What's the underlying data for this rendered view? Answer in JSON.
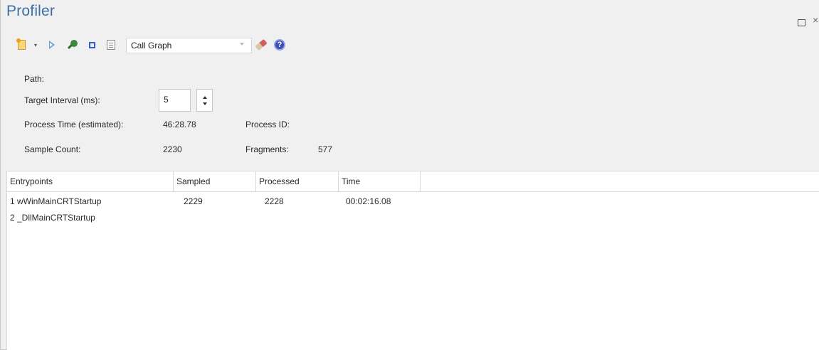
{
  "window": {
    "title": "Profiler",
    "maximize_glyph": "",
    "close_glyph": "×"
  },
  "toolbar": {
    "icons": [
      "new-document-icon",
      "chevron-down-icon",
      "play-icon",
      "search-icon",
      "stop-icon",
      "report-icon",
      "eraser-icon",
      "help-icon"
    ],
    "view_select_value": "Call Graph",
    "dropdown_arrow_glyph": "▾",
    "help_glyph": "?"
  },
  "form": {
    "path_label": "Path:",
    "target_interval_label": "Target Interval (ms):",
    "target_interval_value": "5",
    "process_time_label": "Process Time (estimated):",
    "process_time_value": "46:28.78",
    "process_id_label": "Process ID:",
    "sample_count_label": "Sample Count:",
    "sample_count_value": "2230",
    "fragments_label": "Fragments:",
    "fragments_value": "577"
  },
  "grid": {
    "columns": [
      "Entrypoints",
      "Sampled",
      "Processed",
      "Time"
    ],
    "rows": [
      {
        "entrypoint": "1 wWinMainCRTStartup",
        "sampled": "2229",
        "processed": "2228",
        "time": "00:02:16.08"
      },
      {
        "entrypoint": "2 _DllMainCRTStartup",
        "sampled": "",
        "processed": "",
        "time": ""
      }
    ]
  },
  "colors": {
    "title": "#3c6fa6",
    "panel_bg": "#f0f0f0",
    "grid_bg": "#ffffff",
    "stop_icon": "#2f5fcf",
    "search_icon": "#3a8a3a",
    "help_icon": "#3f4fb0"
  }
}
